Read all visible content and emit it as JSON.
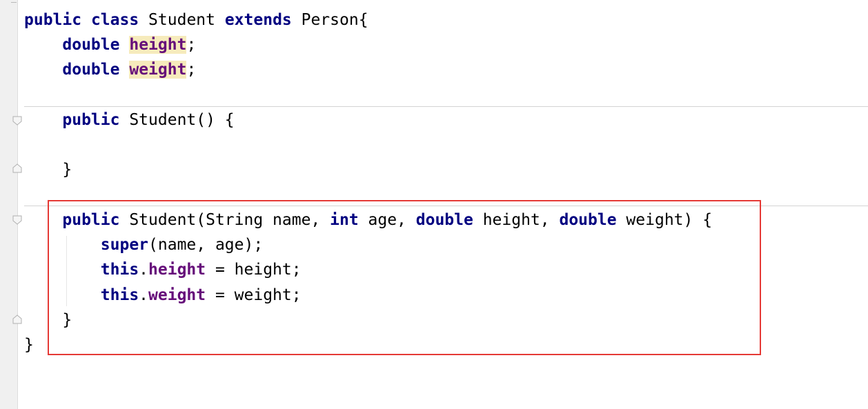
{
  "editor": {
    "lines": {
      "class_decl": {
        "public": "public",
        "space1": " ",
        "class": "class",
        "name": " Student ",
        "extends": "extends",
        "parent": " Person{"
      },
      "field_height": {
        "indent": "    ",
        "type": "double",
        "space": " ",
        "name": "height",
        "end": ";"
      },
      "field_weight": {
        "indent": "    ",
        "type": "double",
        "space": " ",
        "name": "weight",
        "end": ";"
      },
      "ctor1_decl": {
        "indent": "    ",
        "public": "public",
        "rest": " Student() {"
      },
      "ctor1_close": {
        "indent": "    ",
        "brace": "}"
      },
      "ctor2_decl": {
        "indent": "    ",
        "public": "public",
        "t1": " Student(String name, ",
        "int": "int",
        "t2": " age, ",
        "double1": "double",
        "t3": " height, ",
        "double2": "double",
        "t4": " weight) {"
      },
      "super_call": {
        "indent": "        ",
        "super": "super",
        "rest": "(name, age);"
      },
      "this_height": {
        "indent": "        ",
        "this": "this",
        "dot": ".",
        "field": "height",
        "rest": " = height;"
      },
      "this_weight": {
        "indent": "        ",
        "this": "this",
        "dot": ".",
        "field": "weight",
        "rest": " = weight;"
      },
      "ctor2_close": {
        "indent": "    ",
        "brace": "}"
      },
      "class_close": {
        "brace": "}"
      }
    },
    "colors": {
      "keyword": "#000080",
      "field": "#660e7a",
      "usage_highlight": "#f6ebbc",
      "annotation_box": "#e53935"
    }
  }
}
